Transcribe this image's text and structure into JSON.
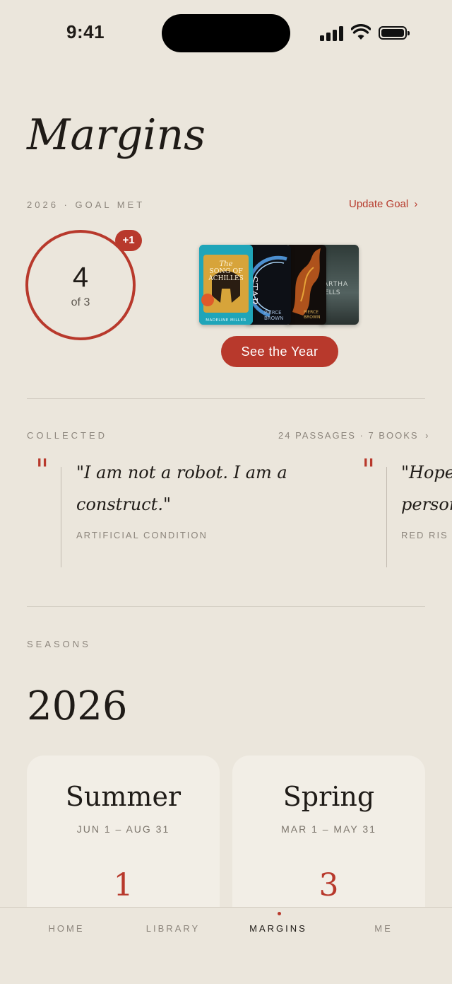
{
  "status": {
    "time": "9:41"
  },
  "header": {
    "title": "Margins"
  },
  "goal": {
    "label": "2026 · GOAL MET",
    "update_label": "Update Goal",
    "count": "4",
    "of_text": "of 3",
    "badge": "+1",
    "covers": [
      "The Song of Achilles",
      "Morning Star",
      "Iron Gold",
      "Martha Wells cover"
    ],
    "see_year_label": "See the Year"
  },
  "collected": {
    "label": "COLLECTED",
    "summary": "24 PASSAGES · 7 BOOKS",
    "quotes": [
      {
        "text": "\"I am not a robot. I am a construct.\"",
        "source": "ARTIFICIAL CONDITION"
      },
      {
        "text": "\"Hope person",
        "source": "RED RIS"
      }
    ]
  },
  "seasons": {
    "label": "SEASONS",
    "year": "2026",
    "cards": [
      {
        "name": "Summer",
        "range": "JUN 1 – AUG 31",
        "count": "1"
      },
      {
        "name": "Spring",
        "range": "MAR 1 – MAY 31",
        "count": "3"
      }
    ]
  },
  "tabs": [
    {
      "label": "HOME"
    },
    {
      "label": "LIBRARY"
    },
    {
      "label": "MARGINS"
    },
    {
      "label": "ME"
    }
  ],
  "colors": {
    "accent": "#b8392c",
    "background": "#ebe6dc",
    "card": "#f2eee6"
  }
}
